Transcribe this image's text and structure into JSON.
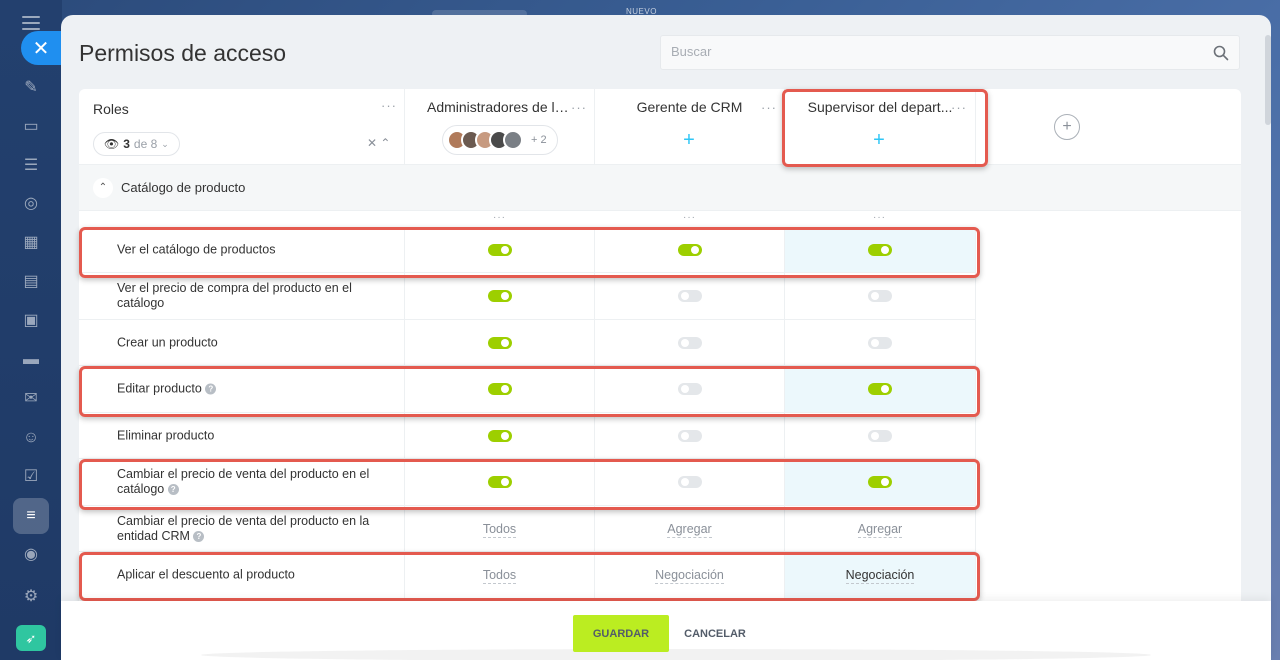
{
  "window": {
    "top_tag": "NUEVO"
  },
  "page": {
    "title": "Permisos de acceso"
  },
  "search": {
    "placeholder": "Buscar"
  },
  "roles_header": {
    "title": "Roles",
    "count_current": "3",
    "count_suffix": "de 8"
  },
  "columns": [
    {
      "name": "Administradores de la...",
      "extra_members": "+ 2"
    },
    {
      "name": "Gerente de CRM"
    },
    {
      "name": "Supervisor del depart..."
    }
  ],
  "section": {
    "title": "Catálogo de producto"
  },
  "rows": [
    {
      "label": "Ver el catálogo de productos",
      "help": false,
      "values": [
        "on",
        "on",
        "on"
      ]
    },
    {
      "label": "Ver el precio de compra del producto en el catálogo",
      "help": false,
      "values": [
        "on",
        "off",
        "off"
      ]
    },
    {
      "label": "Crear un producto",
      "help": false,
      "values": [
        "on",
        "off",
        "off"
      ]
    },
    {
      "label": "Editar producto",
      "help": true,
      "values": [
        "on",
        "off",
        "on"
      ]
    },
    {
      "label": "Eliminar producto",
      "help": false,
      "values": [
        "on",
        "off",
        "off"
      ]
    },
    {
      "label": "Cambiar el precio de venta del producto en el catálogo",
      "help": true,
      "values": [
        "on",
        "off",
        "on"
      ]
    },
    {
      "label": "Cambiar el precio de venta del producto en la entidad CRM",
      "help": true,
      "values": [
        "Todos",
        "Agregar",
        "Agregar"
      ]
    },
    {
      "label": "Aplicar el descuento al producto",
      "help": false,
      "values": [
        "Todos",
        "Negociación",
        "Negociación"
      ]
    }
  ],
  "footer": {
    "save_label": "GUARDAR",
    "cancel_label": "CANCELAR"
  },
  "colors": {
    "toggle_on": "#9dcf00",
    "toggle_off": "#e4e7ea",
    "save_button": "#bbed21",
    "highlight_box": "#e45a4f",
    "add_role_plus": "#2fc6f6"
  },
  "icons": {
    "sidebar": [
      "menu-icon",
      "close-icon",
      "feed-icon",
      "chat-icon",
      "tasks-icon",
      "crm-icon",
      "calendar-icon",
      "docs-icon",
      "sites-icon",
      "store-icon",
      "mail-icon",
      "contacts-icon",
      "checklist-icon",
      "filter-icon",
      "robot-icon",
      "settings-icon",
      "rocket-icon"
    ]
  }
}
